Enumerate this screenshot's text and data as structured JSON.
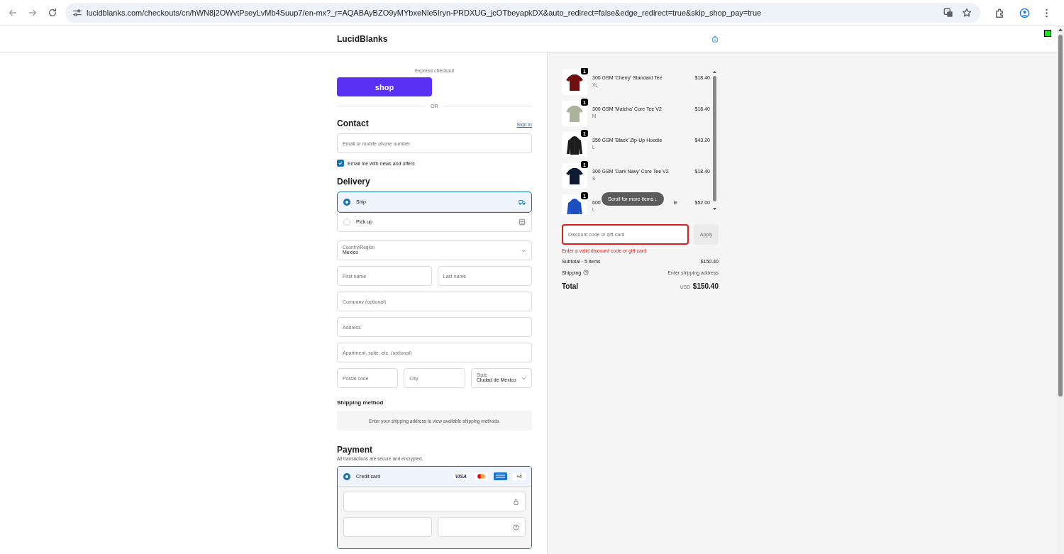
{
  "browser": {
    "url": "lucidblanks.com/checkouts/cn/hWN8j2OWvtPseyLvMb4Suup7/en-mx?_r=AQABAyBZO9yMYbxeNle5Iryn-PRDXUG_jcOTbeyapkDX&auto_redirect=false&edge_redirect=true&skip_shop_pay=true"
  },
  "header": {
    "store_name": "LucidBlanks"
  },
  "express": {
    "label": "Express checkout",
    "button": "shop",
    "divider": "OR"
  },
  "contact": {
    "title": "Contact",
    "sign_in": "Sign in",
    "email_placeholder": "Email or mobile phone number",
    "newsletter": {
      "label": "Email me with news and offers",
      "checked": true
    }
  },
  "delivery": {
    "title": "Delivery",
    "options": [
      {
        "kind": "ship",
        "label": "Ship",
        "selected": true
      },
      {
        "kind": "pickup",
        "label": "Pick up",
        "selected": false
      }
    ],
    "country": {
      "label": "Country/Region",
      "value": "Mexico"
    },
    "rows": [
      [
        {
          "kind": "input",
          "placeholder": "First name"
        },
        {
          "kind": "input",
          "placeholder": "Last name"
        }
      ],
      [
        {
          "kind": "input",
          "placeholder": "Company (optional)"
        }
      ],
      [
        {
          "kind": "input",
          "placeholder": "Address"
        }
      ],
      [
        {
          "kind": "input",
          "placeholder": "Apartment, suite, etc. (optional)"
        }
      ],
      [
        {
          "kind": "input",
          "placeholder": "Postal code"
        },
        {
          "kind": "input",
          "placeholder": "City"
        },
        {
          "kind": "select",
          "label": "State",
          "value": "Ciudad de Mexico"
        }
      ]
    ]
  },
  "shipping_method": {
    "title": "Shipping method",
    "message": "Enter your shipping address to view available shipping methods."
  },
  "payment": {
    "title": "Payment",
    "subtitle": "All transactions are secure and encrypted.",
    "methods": [
      {
        "label": "Credit card",
        "selected": true,
        "brand": "VISA",
        "more": "+4"
      }
    ]
  },
  "summary": {
    "items": [
      {
        "quantity": "1",
        "name": "300 GSM 'Cherry' Standard Tee",
        "size": "XL",
        "price": "$18.40"
      },
      {
        "quantity": "1",
        "name": "300 GSM 'Matcha' Core Tee V2",
        "size": "M",
        "price": "$18.40"
      },
      {
        "quantity": "1",
        "name": "350 GSM 'Black' Zip-Up Hoodie",
        "size": "L",
        "price": "$43.20"
      },
      {
        "quantity": "1",
        "name": "300 GSM 'Dark Navy' Core Tee V2",
        "size": "S",
        "price": "$18.40"
      },
      {
        "quantity": "1",
        "name_start": "600",
        "name_end": "ie",
        "size": "L",
        "price": "$52.00"
      }
    ],
    "scroll_hint": "Scroll for more items ↓",
    "discount": {
      "placeholder": "Discount code or gift card",
      "button": "Apply",
      "invalid": true,
      "error": "Enter a valid discount code or gift card"
    },
    "subtotal_label": "Subtotal · 5 items",
    "subtotal": "$150.40",
    "shipping_label": "Shipping",
    "shipping_value": "Enter shipping address",
    "total_label": "Total",
    "currency": "USD",
    "total": "$150.40"
  }
}
